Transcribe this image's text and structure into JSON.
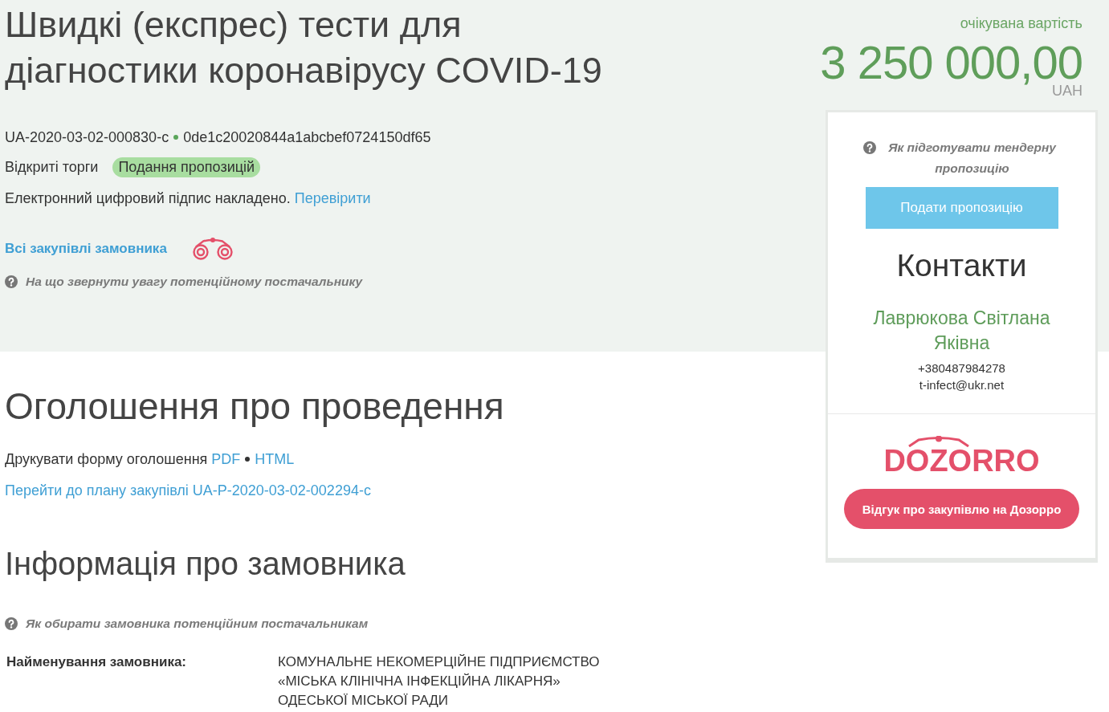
{
  "tender": {
    "title": "Швидкі (експрес) тести для діагностики коронавірусу COVID-19",
    "id": "UA-2020-03-02-000830-c",
    "hash": "0de1c20020844a1abcbef0724150df65",
    "procedure": "Відкриті торги",
    "status": "Подання пропозицій",
    "signature_text": "Електронний цифровий підпис накладено.",
    "signature_link": "Перевірити",
    "customer_link": "Всі закупівлі замовника",
    "hint": "На що звернути увагу потенційному постачальнику"
  },
  "price": {
    "label": "очікувана вартість",
    "amount": "3 250 000,00",
    "currency": "UAH"
  },
  "sidebar": {
    "hint": "Як підготувати тендерну пропозицію",
    "submit_button": "Подати пропозицію",
    "contacts": {
      "heading": "Контакти",
      "name": "Лаврюкова Світлана Яківна",
      "phone": "+380487984278",
      "email": "t-infect@ukr.net"
    },
    "logo": "DOZORRO",
    "feedback_button": "Відгук про закупівлю на Дозорро"
  },
  "announcement": {
    "heading": "Оголошення про проведення",
    "print_label": "Друкувати форму оголошення",
    "print_links": [
      "PDF",
      "HTML"
    ],
    "plan_link": "Перейти до плану закупівлі UA-P-2020-03-02-002294-c"
  },
  "customer": {
    "heading": "Інформація про замовника",
    "hint": "Як обирати замовника потенційним постачальникам",
    "fields": [
      {
        "label": "Найменування замовника:",
        "value": "КОМУНАЛЬНЕ НЕКОМЕРЦІЙНЕ ПІДПРИЄМСТВО «МІСЬКА КЛІНІЧНА ІНФЕКЦІЙНА ЛІКАРНЯ» ОДЕСЬКОЇ МІСЬКОЇ РАДИ"
      }
    ]
  }
}
